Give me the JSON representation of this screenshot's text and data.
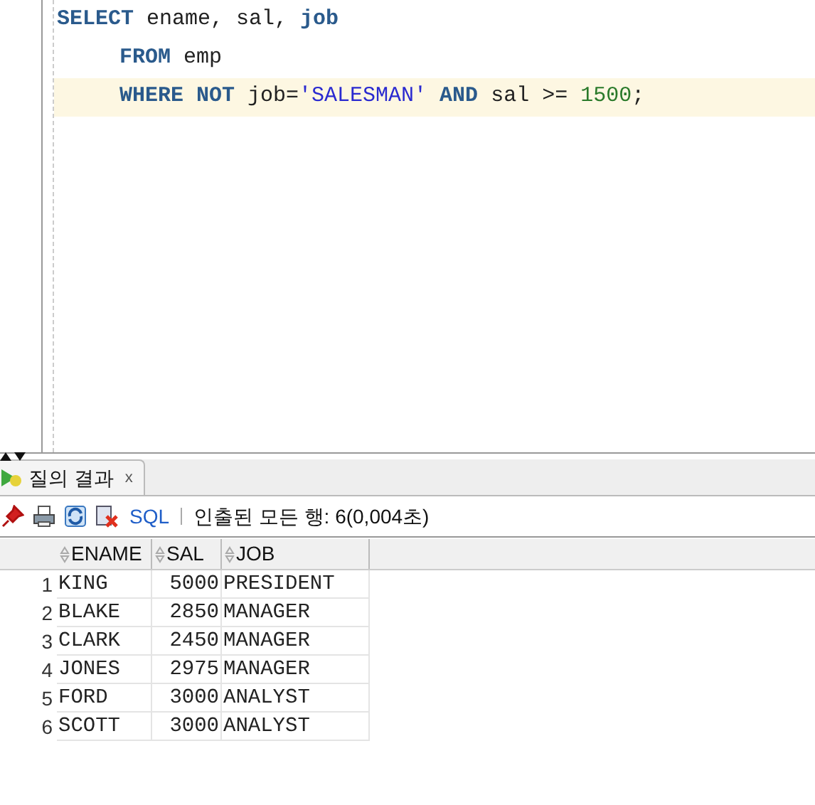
{
  "editor": {
    "lines": [
      {
        "indent": false,
        "current": false,
        "tokens": [
          {
            "kind": "keyword",
            "text": "SELECT"
          },
          {
            "kind": "ident",
            "text": " ename, sal, "
          },
          {
            "kind": "keyword",
            "text": "job"
          }
        ]
      },
      {
        "indent": true,
        "current": false,
        "tokens": [
          {
            "kind": "keyword",
            "text": "FROM"
          },
          {
            "kind": "ident",
            "text": " emp"
          }
        ]
      },
      {
        "indent": true,
        "current": true,
        "tokens": [
          {
            "kind": "keyword",
            "text": "WHERE NOT"
          },
          {
            "kind": "ident",
            "text": " job="
          },
          {
            "kind": "string",
            "text": "'SALESMAN'"
          },
          {
            "kind": "keyword",
            "text": " AND"
          },
          {
            "kind": "ident",
            "text": " sal >= "
          },
          {
            "kind": "number",
            "text": "1500"
          },
          {
            "kind": "ident",
            "text": ";"
          }
        ]
      }
    ]
  },
  "results_tab": {
    "label": "질의 결과",
    "close": "x"
  },
  "toolbar": {
    "sql_link": "SQL",
    "status": "인출된 모든 행: 6(0,004초)"
  },
  "table": {
    "columns": [
      "ENAME",
      "SAL",
      "JOB"
    ],
    "rows": [
      {
        "num": "1",
        "cells": [
          "KING",
          "5000",
          "PRESIDENT"
        ]
      },
      {
        "num": "2",
        "cells": [
          "BLAKE",
          "2850",
          "MANAGER"
        ]
      },
      {
        "num": "3",
        "cells": [
          "CLARK",
          "2450",
          "MANAGER"
        ]
      },
      {
        "num": "4",
        "cells": [
          "JONES",
          "2975",
          "MANAGER"
        ]
      },
      {
        "num": "5",
        "cells": [
          "FORD",
          "3000",
          "ANALYST"
        ]
      },
      {
        "num": "6",
        "cells": [
          "SCOTT",
          "3000",
          "ANALYST"
        ]
      }
    ]
  }
}
